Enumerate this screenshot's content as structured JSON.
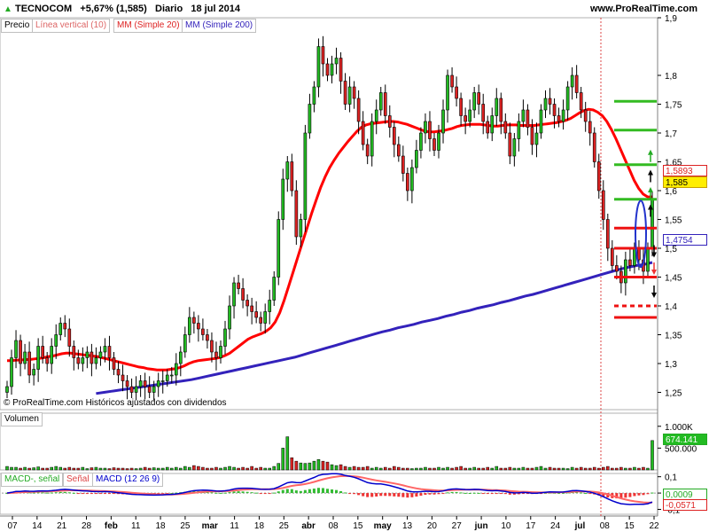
{
  "header": {
    "symbol": "TECNOCOM",
    "change": "+5,67% (1,585)",
    "period": "Diario",
    "date": "18 jul 2014",
    "site": "www.ProRealTime.com",
    "attribution": "© ProRealTime.com Históricos ajustados con dividendos"
  },
  "colors": {
    "up": "#22bb22",
    "down": "#dd2222",
    "ma20": "#ff0000",
    "ma200": "#3322bb",
    "macd": "#0000cc",
    "signal": "#ff6666"
  },
  "legends": {
    "price": "Precio",
    "vline": "Línea vertical (10)",
    "ma20": "MM (Simple 20)",
    "ma200": "MM (Simple 200)",
    "volume": "Volumen",
    "macd_hist": "MACD-, señal",
    "signal": "Señal",
    "macd": "MACD (12 26 9)"
  },
  "price_tags": {
    "ma20": "1,5893",
    "last": "1,585",
    "ma200": "1,4754",
    "volume": "674.141",
    "macd": "0,0009",
    "hist": "-0,0571"
  },
  "chart_data": {
    "type": "candlestick",
    "x_labels": [
      "07",
      "14",
      "21",
      "28",
      "feb",
      "11",
      "18",
      "25",
      "mar",
      "11",
      "18",
      "25",
      "abr",
      "08",
      "15",
      "may",
      "13",
      "20",
      "27",
      "jun",
      "10",
      "17",
      "24",
      "jul",
      "08",
      "15",
      "22"
    ],
    "price_axis": {
      "ticks": [
        "1,9",
        "1,8",
        "1,75",
        "1,7",
        "1,65",
        "1,6",
        "1,55",
        "1,5",
        "1,45",
        "1,4",
        "1,35",
        "1,3",
        "1,25"
      ],
      "ylim": [
        1.22,
        1.9
      ]
    },
    "volume_axis": {
      "ticks": [
        "1.000K",
        "500.000"
      ],
      "ylim": [
        0,
        1300000
      ]
    },
    "macd_axis": {
      "ticks": [
        "0,1",
        "0",
        "-0,1"
      ],
      "ylim": [
        -0.13,
        0.12
      ]
    },
    "last_close": 1.585,
    "ma20_last": 1.5893,
    "ma200_last": 1.4754,
    "volume_last": 674141,
    "macd_last": 0.0009,
    "hist_last": -0.0571,
    "levels": {
      "green": [
        1.585,
        1.645,
        1.705,
        1.755
      ],
      "red": [
        1.535,
        1.5,
        1.45,
        1.38
      ],
      "red_dashed": [
        1.4
      ]
    },
    "closes": [
      1.26,
      1.31,
      1.34,
      1.3,
      1.32,
      1.28,
      1.29,
      1.33,
      1.31,
      1.3,
      1.33,
      1.35,
      1.37,
      1.36,
      1.33,
      1.31,
      1.3,
      1.31,
      1.32,
      1.3,
      1.31,
      1.32,
      1.33,
      1.31,
      1.29,
      1.28,
      1.27,
      1.26,
      1.25,
      1.26,
      1.27,
      1.26,
      1.25,
      1.26,
      1.27,
      1.27,
      1.28,
      1.28,
      1.3,
      1.32,
      1.35,
      1.38,
      1.37,
      1.36,
      1.35,
      1.34,
      1.32,
      1.31,
      1.33,
      1.36,
      1.4,
      1.44,
      1.43,
      1.41,
      1.4,
      1.39,
      1.38,
      1.37,
      1.39,
      1.41,
      1.45,
      1.55,
      1.62,
      1.65,
      1.6,
      1.52,
      1.55,
      1.7,
      1.75,
      1.78,
      1.85,
      1.82,
      1.8,
      1.82,
      1.83,
      1.79,
      1.75,
      1.78,
      1.76,
      1.72,
      1.68,
      1.66,
      1.72,
      1.74,
      1.77,
      1.73,
      1.71,
      1.68,
      1.66,
      1.63,
      1.6,
      1.64,
      1.67,
      1.7,
      1.72,
      1.69,
      1.67,
      1.7,
      1.74,
      1.8,
      1.78,
      1.76,
      1.73,
      1.72,
      1.74,
      1.77,
      1.75,
      1.72,
      1.7,
      1.73,
      1.76,
      1.72,
      1.7,
      1.66,
      1.69,
      1.72,
      1.74,
      1.71,
      1.68,
      1.7,
      1.74,
      1.76,
      1.75,
      1.73,
      1.72,
      1.74,
      1.78,
      1.8,
      1.77,
      1.74,
      1.72,
      1.7,
      1.65,
      1.6,
      1.55,
      1.5,
      1.47,
      1.46,
      1.44,
      1.48,
      1.47,
      1.5,
      1.48,
      1.46,
      1.5,
      1.585
    ],
    "volumes": [
      80,
      60,
      60,
      40,
      60,
      40,
      50,
      70,
      40,
      40,
      60,
      80,
      60,
      40,
      60,
      40,
      40,
      60,
      30,
      50,
      60,
      40,
      40,
      30,
      50,
      40,
      40,
      30,
      40,
      30,
      40,
      60,
      40,
      50,
      40,
      40,
      60,
      40,
      60,
      40,
      80,
      60,
      100,
      80,
      60,
      40,
      40,
      60,
      40,
      60,
      80,
      60,
      40,
      60,
      40,
      80,
      40,
      60,
      40,
      40,
      80,
      150,
      500,
      760,
      280,
      200,
      160,
      150,
      160,
      200,
      240,
      200,
      180,
      120,
      100,
      120,
      80,
      60,
      80,
      60,
      60,
      80,
      40,
      60,
      40,
      60,
      40,
      80,
      60,
      40,
      40,
      30,
      40,
      40,
      60,
      40,
      40,
      60,
      40,
      60,
      40,
      60,
      80,
      40,
      40,
      60,
      40,
      40,
      60,
      40,
      80,
      40,
      40,
      60,
      40,
      40,
      60,
      40,
      40,
      60,
      80,
      40,
      60,
      40,
      40,
      40,
      30,
      60,
      40,
      60,
      40,
      40,
      60,
      40,
      60,
      80,
      40,
      40,
      60,
      40,
      40,
      60,
      40,
      60,
      40,
      674
    ],
    "ma20": [
      1.305,
      1.305,
      1.306,
      1.306,
      1.307,
      1.307,
      1.308,
      1.309,
      1.31,
      1.312,
      1.313,
      1.315,
      1.317,
      1.318,
      1.318,
      1.317,
      1.316,
      1.315,
      1.314,
      1.313,
      1.312,
      1.31,
      1.308,
      1.306,
      1.304,
      1.302,
      1.3,
      1.298,
      1.296,
      1.294,
      1.293,
      1.291,
      1.29,
      1.289,
      1.289,
      1.289,
      1.29,
      1.291,
      1.293,
      1.296,
      1.3,
      1.303,
      1.305,
      1.306,
      1.307,
      1.308,
      1.309,
      1.311,
      1.314,
      1.318,
      1.324,
      1.33,
      1.336,
      1.342,
      1.346,
      1.349,
      1.352,
      1.356,
      1.362,
      1.372,
      1.388,
      1.41,
      1.435,
      1.46,
      1.485,
      1.51,
      1.535,
      1.56,
      1.583,
      1.605,
      1.624,
      1.64,
      1.653,
      1.665,
      1.675,
      1.685,
      1.694,
      1.703,
      1.71,
      1.714,
      1.716,
      1.717,
      1.718,
      1.719,
      1.72,
      1.72,
      1.719,
      1.717,
      1.715,
      1.712,
      1.709,
      1.706,
      1.703,
      1.702,
      1.702,
      1.703,
      1.704,
      1.706,
      1.708,
      1.711,
      1.713,
      1.714,
      1.715,
      1.715,
      1.715,
      1.714,
      1.713,
      1.712,
      1.712,
      1.713,
      1.714,
      1.714,
      1.714,
      1.713,
      1.713,
      1.713,
      1.713,
      1.714,
      1.715,
      1.716,
      1.717,
      1.718,
      1.72,
      1.722,
      1.725,
      1.73,
      1.735,
      1.739,
      1.741,
      1.74,
      1.736,
      1.73,
      1.72,
      1.706,
      1.69,
      1.672,
      1.654,
      1.636,
      1.618,
      1.604,
      1.594,
      1.589,
      1.5893
    ],
    "ma200": [
      1.248,
      1.25,
      1.252,
      1.254,
      1.256,
      1.258,
      1.26,
      1.262,
      1.264,
      1.266,
      1.268,
      1.27,
      1.272,
      1.275,
      1.278,
      1.281,
      1.284,
      1.287,
      1.29,
      1.293,
      1.296,
      1.299,
      1.302,
      1.305,
      1.308,
      1.311,
      1.315,
      1.319,
      1.323,
      1.327,
      1.331,
      1.335,
      1.339,
      1.343,
      1.347,
      1.351,
      1.355,
      1.358,
      1.362,
      1.365,
      1.368,
      1.372,
      1.375,
      1.378,
      1.382,
      1.385,
      1.389,
      1.392,
      1.396,
      1.399,
      1.402,
      1.406,
      1.409,
      1.413,
      1.417,
      1.42,
      1.424,
      1.428,
      1.432,
      1.436,
      1.44,
      1.444,
      1.448,
      1.452,
      1.456,
      1.46,
      1.464,
      1.467,
      1.47,
      1.472,
      1.4754
    ]
  }
}
